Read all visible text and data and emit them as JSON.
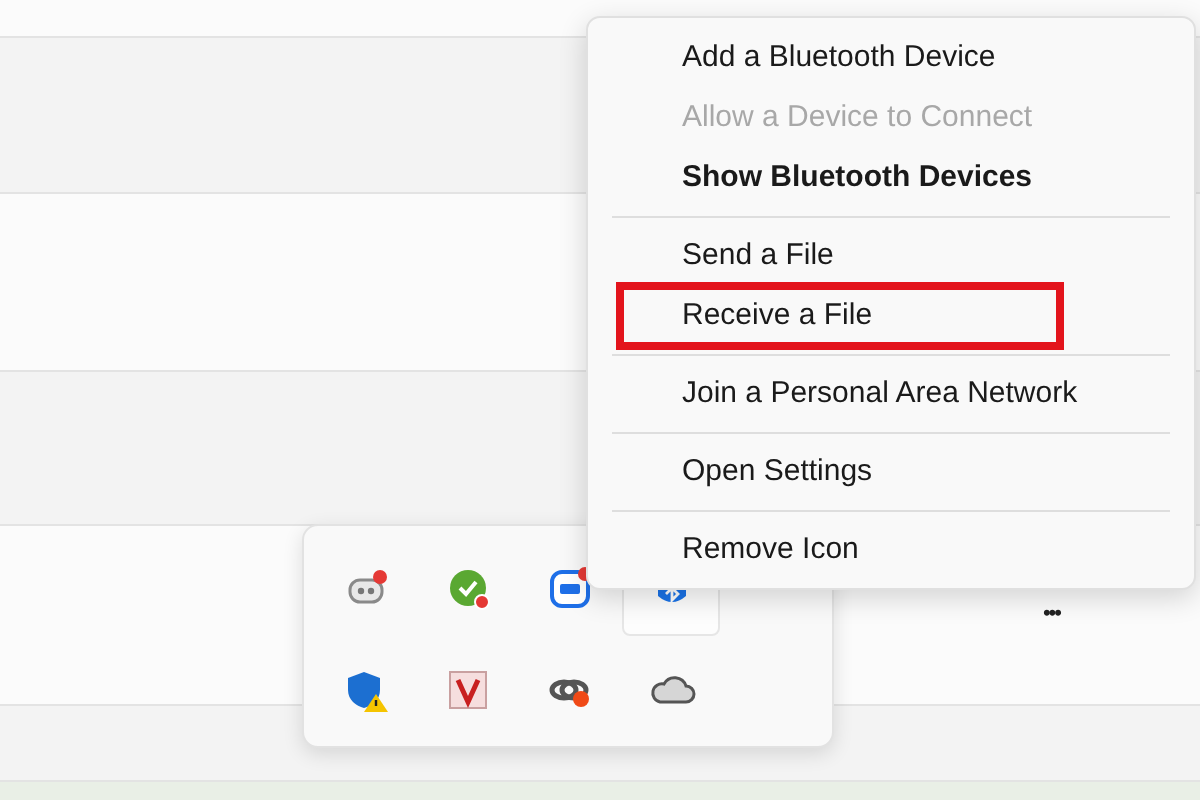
{
  "more_button": "•••",
  "tray_flyout": {
    "icons": [
      {
        "kind": "chat",
        "selected": false
      },
      {
        "kind": "check",
        "selected": false
      },
      {
        "kind": "zalo",
        "selected": false
      },
      {
        "kind": "bluetooth",
        "selected": true
      },
      {
        "kind": "shield",
        "selected": false
      },
      {
        "kind": "v",
        "selected": false
      },
      {
        "kind": "link",
        "selected": false
      },
      {
        "kind": "cloud",
        "selected": false
      }
    ]
  },
  "context_menu": {
    "groups": [
      [
        {
          "label": "Add a Bluetooth Device",
          "disabled": false,
          "bold": false,
          "highlighted": false
        },
        {
          "label": "Allow a Device to Connect",
          "disabled": true,
          "bold": false,
          "highlighted": false
        },
        {
          "label": "Show Bluetooth Devices",
          "disabled": false,
          "bold": true,
          "highlighted": false
        }
      ],
      [
        {
          "label": "Send a File",
          "disabled": false,
          "bold": false,
          "highlighted": false
        },
        {
          "label": "Receive a File",
          "disabled": false,
          "bold": false,
          "highlighted": true
        }
      ],
      [
        {
          "label": "Join a Personal Area Network",
          "disabled": false,
          "bold": false,
          "highlighted": false
        }
      ],
      [
        {
          "label": "Open Settings",
          "disabled": false,
          "bold": false,
          "highlighted": false
        }
      ],
      [
        {
          "label": "Remove Icon",
          "disabled": false,
          "bold": false,
          "highlighted": false
        }
      ]
    ]
  }
}
